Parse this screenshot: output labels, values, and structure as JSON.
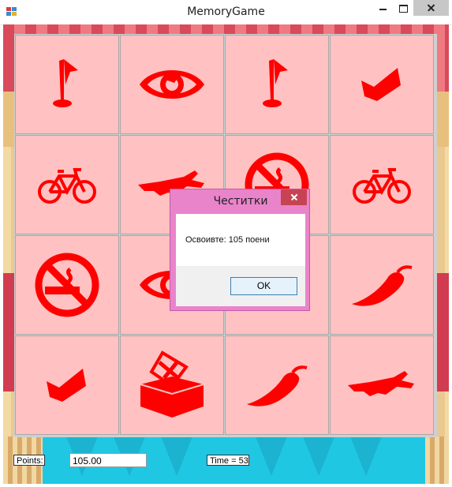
{
  "window": {
    "title": "MemoryGame"
  },
  "board": {
    "icon_color": "#ff0000",
    "card_color": "#ffc1c1",
    "cards": [
      {
        "icon": "golf-flag-icon"
      },
      {
        "icon": "eye-icon"
      },
      {
        "icon": "golf-flag-icon"
      },
      {
        "icon": "checkmark-icon"
      },
      {
        "icon": "bicycle-icon"
      },
      {
        "icon": "airplane-icon"
      },
      {
        "icon": "no-smoking-icon"
      },
      {
        "icon": "bicycle-icon"
      },
      {
        "icon": "no-smoking-icon"
      },
      {
        "icon": "eye-icon"
      },
      {
        "icon": "hidden-icon"
      },
      {
        "icon": "chili-pepper-icon"
      },
      {
        "icon": "checkmark-icon"
      },
      {
        "icon": "ballot-box-icon"
      },
      {
        "icon": "chili-pepper-icon"
      },
      {
        "icon": "airplane-icon"
      }
    ]
  },
  "status": {
    "points_label": "Points:",
    "points_value": "105.00",
    "time_label": "Time = 53"
  },
  "dialog": {
    "title": "Честитки",
    "message": "Освоивте: 105 поени",
    "ok_label": "OK"
  }
}
